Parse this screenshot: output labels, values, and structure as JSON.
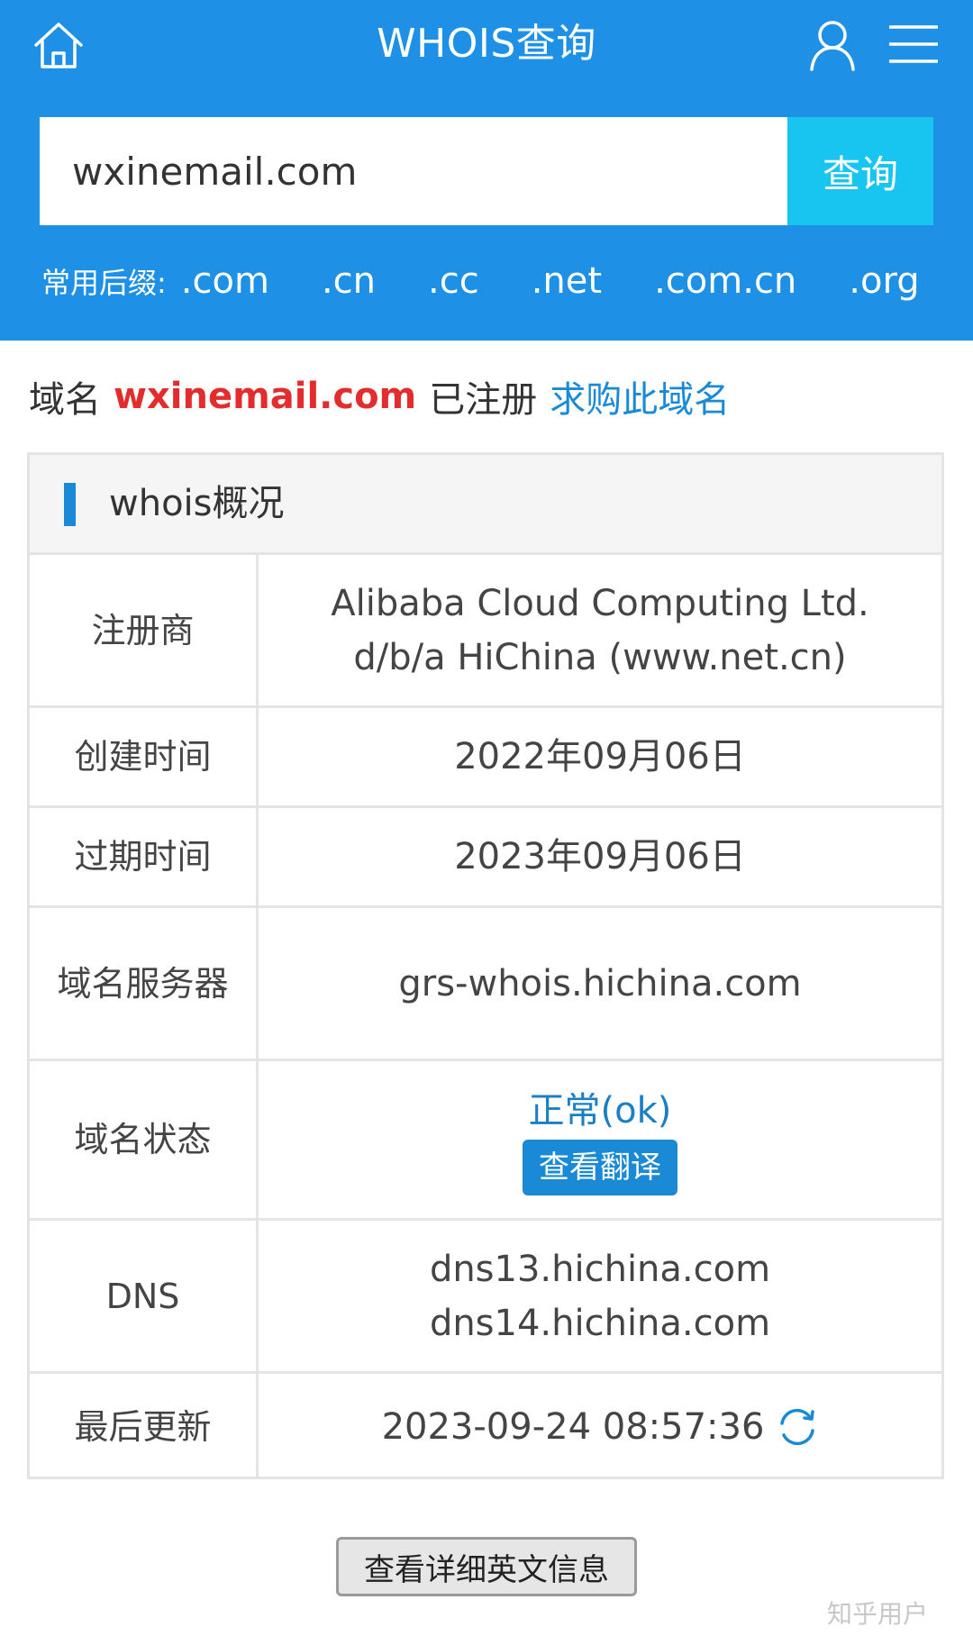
{
  "header": {
    "title": "WHOIS查询",
    "icons": {
      "home": "home-icon",
      "user": "user-icon",
      "menu": "menu-icon"
    },
    "background_color": "#1e90e6"
  },
  "search": {
    "value": "wxinemail.com",
    "button_label": "查询",
    "button_color": "#18c5f0"
  },
  "suffixes": {
    "label": "常用后缀:",
    "items": [
      ".com",
      ".cn",
      ".cc",
      ".net",
      ".com.cn",
      ".org"
    ]
  },
  "result": {
    "prefix": "域名",
    "domain": "wxinemail.com",
    "status_text": "已注册",
    "buy_link": "求购此域名",
    "domain_color": "#e32d2d",
    "link_color": "#1a8ad6"
  },
  "whois": {
    "title": "whois概况",
    "rows": [
      {
        "label": "注册商",
        "value": "Alibaba Cloud Computing Ltd. d/b/a HiChina (www.net.cn)"
      },
      {
        "label": "创建时间",
        "value": "2022年09月06日"
      },
      {
        "label": "过期时间",
        "value": "2023年09月06日"
      },
      {
        "label": "域名服务器",
        "value": "grs-whois.hichina.com"
      },
      {
        "label": "域名状态",
        "value": "正常(ok)",
        "button": "查看翻译"
      },
      {
        "label": "DNS",
        "values": [
          "dns13.hichina.com",
          "dns14.hichina.com"
        ]
      },
      {
        "label": "最后更新",
        "value": "2023-09-24 08:57:36",
        "icon": "refresh-icon"
      }
    ]
  },
  "detail_button": "查看详细英文信息",
  "watermark": "知乎用户"
}
